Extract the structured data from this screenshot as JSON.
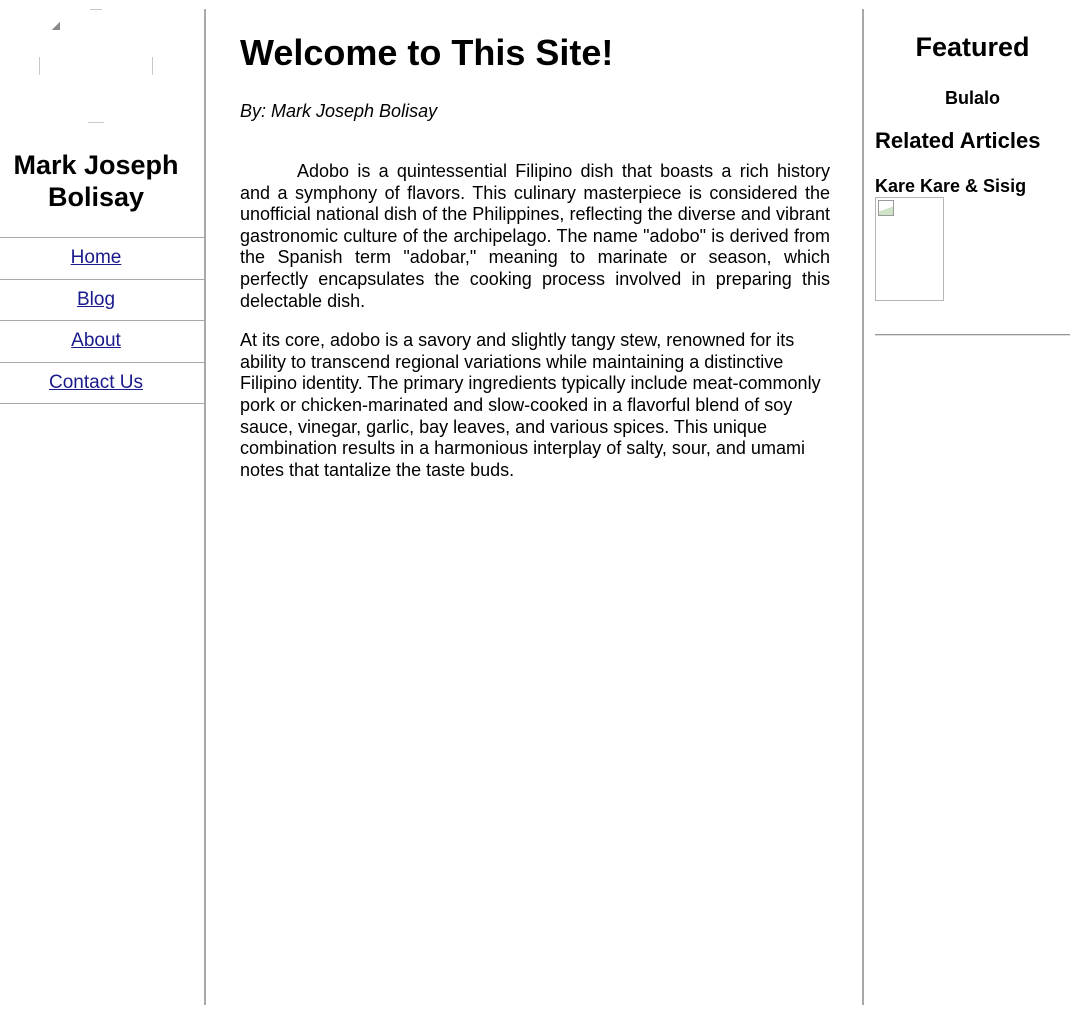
{
  "sidebar": {
    "logo_icon": "broken-image-icon",
    "site_name": "Mark Joseph Bolisay",
    "nav": [
      {
        "label": "Home"
      },
      {
        "label": "Blog"
      },
      {
        "label": "About"
      },
      {
        "label": "Contact Us"
      }
    ],
    "link_color": "#1a1a8c"
  },
  "main": {
    "title": "Welcome to This Site!",
    "byline": "By: Mark Joseph Bolisay",
    "paragraphs": [
      "Adobo is a quintessential Filipino dish that boasts a rich history and a symphony of flavors. This culinary masterpiece is considered the unofficial national dish of the Philippines, reflecting the diverse and vibrant gastronomic culture of the archipelago. The name \"adobo\" is derived from the Spanish term \"adobar,\" meaning to marinate or season, which perfectly encapsulates the cooking process involved in preparing this delectable dish.",
      "At its core, adobo is a savory and slightly tangy stew, renowned for its ability to transcend regional variations while maintaining a distinctive Filipino identity. The primary ingredients typically include meat-commonly pork or chicken-marinated and slow-cooked in a flavorful blend of soy sauce, vinegar, garlic, bay leaves, and various spices. This unique combination results in a harmonious interplay of salty, sour, and umami notes that tantalize the taste buds."
    ]
  },
  "aside": {
    "featured_heading": "Featured",
    "featured_item": "Bulalo",
    "related_heading": "Related Articles",
    "related_title": "Kare Kare & Sisig",
    "related_image_icon": "broken-image-icon"
  }
}
